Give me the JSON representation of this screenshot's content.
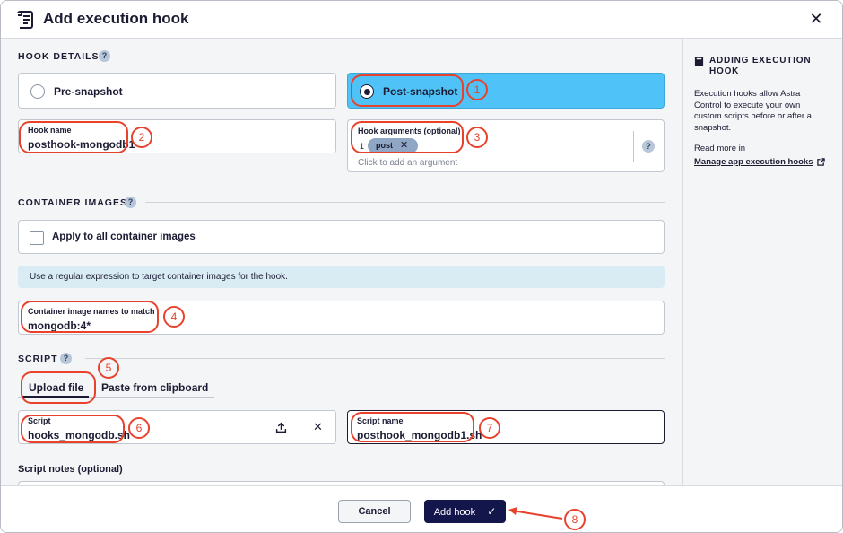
{
  "dialog": {
    "title": "Add execution hook",
    "close_icon": "close-icon"
  },
  "hook_details": {
    "heading": "HOOK DETAILS",
    "help": "?",
    "pre_label": "Pre-snapshot",
    "post_label": "Post-snapshot",
    "selected": "Post-snapshot",
    "hook_name_label": "Hook name",
    "hook_name_value": "posthook-mongodb1",
    "args_label": "Hook arguments (optional)",
    "args_index": "1",
    "args_chip": "post",
    "args_placeholder": "Click to add an argument",
    "args_help": "?"
  },
  "container_images": {
    "heading": "CONTAINER IMAGES",
    "help": "?",
    "apply_all_label": "Apply to all container images",
    "info": "Use a regular expression to target container images for the hook.",
    "match_label": "Container image names to match",
    "match_value": "mongodb:4*"
  },
  "script": {
    "heading": "SCRIPT",
    "help": "?",
    "tabs": [
      "Upload file",
      "Paste from clipboard"
    ],
    "active_tab": "Upload file",
    "script_label": "Script",
    "script_value": "hooks_mongodb.sh",
    "script_name_label": "Script name",
    "script_name_value": "posthook_mongodb1.sh",
    "notes_label": "Script notes (optional)"
  },
  "sidebar": {
    "title_line1": "ADDING EXECUTION",
    "title_line2": "HOOK",
    "body": "Execution hooks allow Astra Control to execute your own custom scripts before or after a snapshot.",
    "read_more": "Read more in",
    "link": "Manage app execution hooks"
  },
  "footer": {
    "cancel": "Cancel",
    "add": "Add hook"
  },
  "callouts": [
    "1",
    "2",
    "3",
    "4",
    "5",
    "6",
    "7",
    "8"
  ],
  "colors": {
    "accent": "#4fc3f7",
    "callout": "#e8412c",
    "primary_button": "#13164a"
  }
}
